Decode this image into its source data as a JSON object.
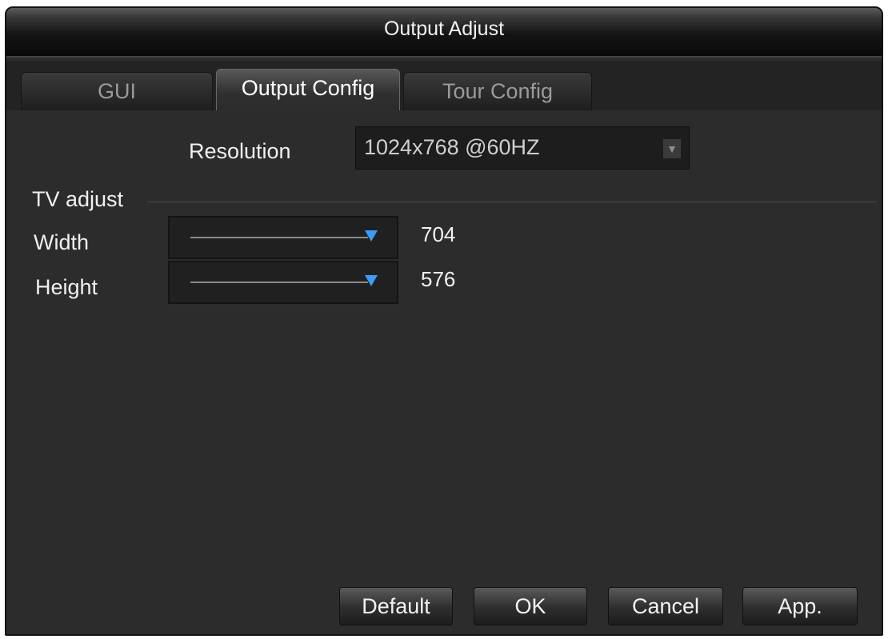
{
  "window": {
    "title": "Output Adjust"
  },
  "tabs": [
    {
      "label": "GUI",
      "active": false
    },
    {
      "label": "Output Config",
      "active": true
    },
    {
      "label": "Tour Config",
      "active": false
    }
  ],
  "resolution": {
    "label": "Resolution",
    "value": "1024x768 @60HZ",
    "arrow_icon": "dropdown-arrow-icon"
  },
  "tv_adjust": {
    "label": "TV adjust",
    "width": {
      "label": "Width",
      "value": "704"
    },
    "height": {
      "label": "Height",
      "value": "576"
    }
  },
  "buttons": {
    "default": "Default",
    "ok": "OK",
    "cancel": "Cancel",
    "apply": "App."
  },
  "colors": {
    "accent": "#3b9bf5",
    "background": "#2c2c2c",
    "text": "#f0f0f0"
  }
}
